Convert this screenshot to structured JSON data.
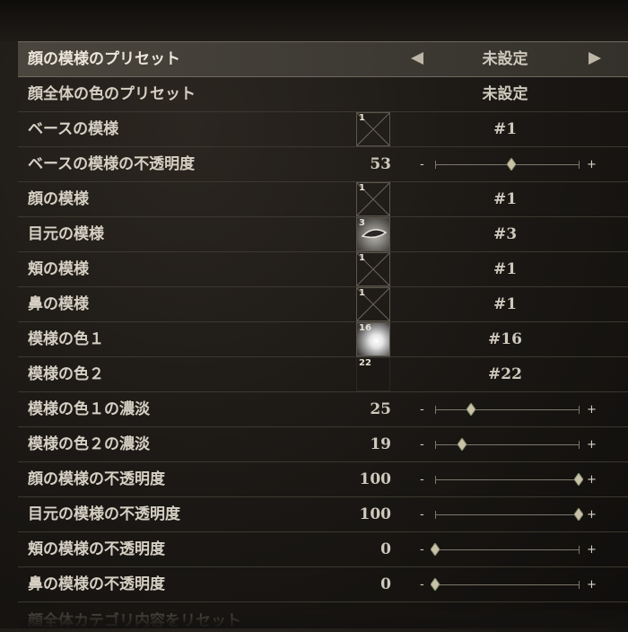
{
  "rows": [
    {
      "label": "顔の模様のプリセット",
      "value": "未設定"
    },
    {
      "label": "顔全体の色のプリセット",
      "value": "未設定"
    },
    {
      "label": "ベースの模様",
      "thumb": "1",
      "value": "#1"
    },
    {
      "label": "ベースの模様の不透明度",
      "num": "53",
      "level": 53
    },
    {
      "label": "顔の模様",
      "thumb": "1",
      "value": "#1"
    },
    {
      "label": "目元の模様",
      "thumb": "3",
      "value": "#3"
    },
    {
      "label": "頬の模様",
      "thumb": "1",
      "value": "#1"
    },
    {
      "label": "鼻の模様",
      "thumb": "1",
      "value": "#1"
    },
    {
      "label": "模様の色１",
      "thumb": "16",
      "value": "#16"
    },
    {
      "label": "模様の色２",
      "thumb": "22",
      "value": "#22"
    },
    {
      "label": "模様の色１の濃淡",
      "num": "25",
      "level": 25
    },
    {
      "label": "模様の色２の濃淡",
      "num": "19",
      "level": 19
    },
    {
      "label": "顔の模様の不透明度",
      "num": "100",
      "level": 100
    },
    {
      "label": "目元の模様の不透明度",
      "num": "100",
      "level": 100
    },
    {
      "label": "頬の模様の不透明度",
      "num": "0",
      "level": 0
    },
    {
      "label": "鼻の模様の不透明度",
      "num": "0",
      "level": 0
    }
  ],
  "slider": {
    "minus": "-",
    "plus": "+"
  },
  "footer_partial_label": "顔全体カテゴリ内容をリセット",
  "colors": {
    "accent": "#bdb6a6",
    "selected_bg": "#4a463e"
  }
}
